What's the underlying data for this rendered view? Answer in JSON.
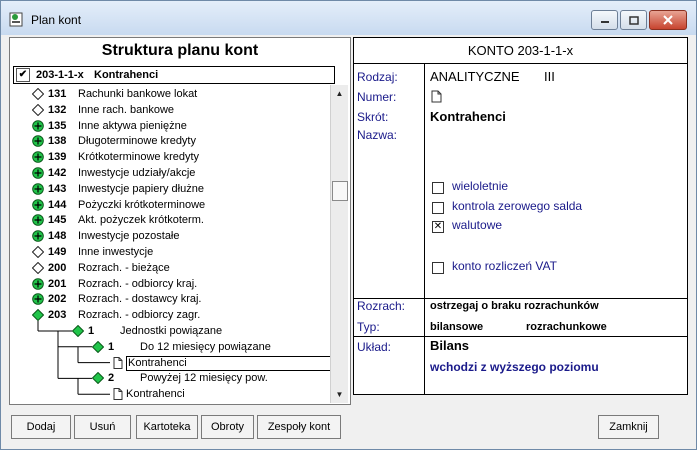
{
  "window": {
    "title": "Plan kont"
  },
  "left": {
    "header": "Struktura planu kont",
    "selected": {
      "code": "203-1-1-x",
      "name": "Kontrahenci"
    },
    "rows": [
      {
        "code": "131",
        "label": "Rachunki bankowe lokat",
        "icon": "white-diamond"
      },
      {
        "code": "132",
        "label": "Inne rach. bankowe",
        "icon": "white-diamond"
      },
      {
        "code": "135",
        "label": "Inne aktywa pieniężne",
        "icon": "plus-circle"
      },
      {
        "code": "138",
        "label": "Długoterminowe kredyty",
        "icon": "plus-circle"
      },
      {
        "code": "139",
        "label": "Krótkoterminowe kredyty",
        "icon": "plus-circle"
      },
      {
        "code": "142",
        "label": "Inwestycje udziały/akcje",
        "icon": "plus-circle"
      },
      {
        "code": "143",
        "label": "Inwestycje papiery dłużne",
        "icon": "plus-circle"
      },
      {
        "code": "144",
        "label": "Pożyczki krótkoterminowe",
        "icon": "plus-circle"
      },
      {
        "code": "145",
        "label": "Akt. pożyczek krótkoterm.",
        "icon": "plus-circle"
      },
      {
        "code": "148",
        "label": "Inwestycje pozostałe",
        "icon": "plus-circle"
      },
      {
        "code": "149",
        "label": "Inne inwestycje",
        "icon": "white-diamond"
      },
      {
        "code": "200",
        "label": "Rozrach. - bieżące",
        "icon": "white-diamond"
      },
      {
        "code": "201",
        "label": "Rozrach. - odbiorcy kraj.",
        "icon": "plus-circle"
      },
      {
        "code": "202",
        "label": "Rozrach. - dostawcy kraj.",
        "icon": "plus-circle"
      },
      {
        "code": "203",
        "label": "Rozrach. - odbiorcy zagr.",
        "icon": "green-diamond"
      },
      {
        "code": "1",
        "label": "Jednostki powiązane",
        "icon": "green-diamond"
      },
      {
        "code": "1",
        "label": "Do 12 miesięcy powiązane",
        "icon": "green-diamond"
      },
      {
        "code": "",
        "label": "Kontrahenci",
        "icon": "document"
      },
      {
        "code": "2",
        "label": "Powyżej 12 miesięcy pow.",
        "icon": "green-diamond"
      },
      {
        "code": "",
        "label": "Kontrahenci",
        "icon": "document"
      }
    ]
  },
  "right": {
    "header": "KONTO  203-1-1-x",
    "rodzaj_label": "Rodzaj:",
    "rodzaj_value": "ANALITYCZNE",
    "rodzaj_level": "III",
    "numer_label": "Numer:",
    "skrot_label": "Skrót:",
    "skrot_value": "Kontrahenci",
    "nazwa_label": "Nazwa:",
    "checkboxes": [
      {
        "label": "wieloletnie",
        "checked": false
      },
      {
        "label": "kontrola zerowego salda",
        "checked": false
      },
      {
        "label": "walutowe",
        "checked": true
      },
      {
        "label": "konto rozliczeń VAT",
        "checked": false
      }
    ],
    "rozrach_label": "Rozrach:",
    "rozrach_value": "ostrzegaj o braku rozrachunków",
    "typ_label": "Typ:",
    "typ_value1": "bilansowe",
    "typ_value2": "rozrachunkowe",
    "uklad_label": "Układ:",
    "uklad_value": "Bilans",
    "uklad_sub": "wchodzi z wyższego poziomu"
  },
  "buttons": {
    "dodaj": "Dodaj",
    "usun": "Usuń",
    "kartoteka": "Kartoteka",
    "obroty": "Obroty",
    "zespoly": "Zespoły kont",
    "zamknij": "Zamknij"
  },
  "colors": {
    "node_green": "#21c44a",
    "accent_blue": "#1a1a8a"
  }
}
